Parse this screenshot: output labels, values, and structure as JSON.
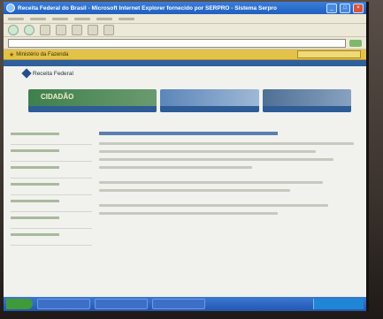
{
  "window": {
    "title": "Receita Federal do Brasil - Microsoft Internet Explorer fornecido por SERPRO - Sistema Serpro"
  },
  "icons": {
    "browser": "ie-icon",
    "favorite": "star-icon",
    "minimize": "minimize-icon",
    "maximize": "maximize-icon",
    "close": "close-icon"
  },
  "favorites_bar": {
    "item_label": "Ministério da Fazenda"
  },
  "site": {
    "logo_text": "Receita Federal",
    "banner_1_label": "CIDADÃO"
  },
  "colors": {
    "titlebar": "#1f5fc0",
    "favorites_bar": "#e3c24a",
    "page_nav": "#2f5f9d",
    "banner_green": "#3f7f4e",
    "taskbar": "#2456b0"
  }
}
